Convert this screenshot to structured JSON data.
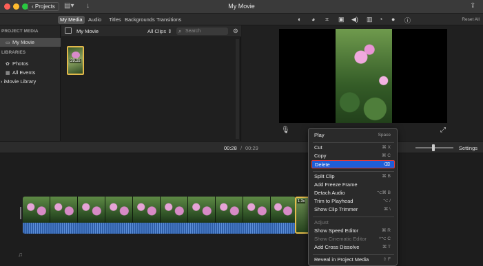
{
  "window": {
    "title": "My Movie",
    "projects_label": "Projects"
  },
  "tabs": [
    "My Media",
    "Audio",
    "Titles",
    "Backgrounds",
    "Transitions"
  ],
  "sidebar": {
    "project_media_heading": "PROJECT MEDIA",
    "project_item": "My Movie",
    "libraries_heading": "LIBRARIES",
    "library_items": [
      "Photos",
      "All Events"
    ],
    "imovie_library": "iMovie Library"
  },
  "browser": {
    "title": "My Movie",
    "filter": "All Clips",
    "search_placeholder": "Search",
    "thumb_duration": "29.2s"
  },
  "viewer": {
    "reset_all": "Reset All"
  },
  "timeline": {
    "current_time": "00:28",
    "separator": "/",
    "total_time": "00:29",
    "settings": "Settings",
    "selected_clip_duration": "1.3s"
  },
  "context_menu": {
    "items": [
      {
        "label": "Play",
        "shortcut": "Space"
      },
      {
        "label": "Cut",
        "shortcut": "⌘ X"
      },
      {
        "label": "Copy",
        "shortcut": "⌘ C"
      },
      {
        "label": "Delete",
        "shortcut": "⌫"
      },
      {
        "label": "Split Clip",
        "shortcut": "⌘ B"
      },
      {
        "label": "Add Freeze Frame",
        "shortcut": ""
      },
      {
        "label": "Detach Audio",
        "shortcut": "⌥⌘ B"
      },
      {
        "label": "Trim to Playhead",
        "shortcut": "⌥ /"
      },
      {
        "label": "Show Clip Trimmer",
        "shortcut": "⌘ \\"
      },
      {
        "label": "Adjust",
        "shortcut": ""
      },
      {
        "label": "Show Speed Editor",
        "shortcut": "⌘ R"
      },
      {
        "label": "Show Cinematic Editor",
        "shortcut": "^⌥ C"
      },
      {
        "label": "Add Cross Dissolve",
        "shortcut": "⌘ T"
      },
      {
        "label": "Reveal in Project Media",
        "shortcut": "⇧ F"
      }
    ]
  },
  "colors": {
    "highlight": "#1f5ed8",
    "selection_border": "#e03a3a",
    "clip_border": "#e4bd4c"
  },
  "icons": [
    "back-chevron-icon",
    "media-layout-icon",
    "download-icon",
    "share-icon",
    "magic-wand-icon",
    "color-balance-icon",
    "color-correction-icon",
    "crop-icon",
    "stabilization-icon",
    "volume-icon",
    "noise-reduction-icon",
    "speed-icon",
    "clip-filter-icon",
    "info-icon",
    "microphone-icon",
    "fullscreen-icon",
    "music-note-icon"
  ]
}
